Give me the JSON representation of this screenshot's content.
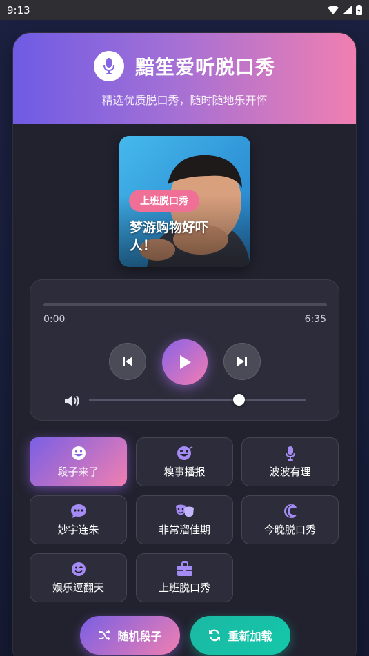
{
  "status_bar": {
    "time": "9:13",
    "icons": [
      "wifi-icon",
      "signal-icon",
      "battery-charging-icon"
    ]
  },
  "header": {
    "title": "黯笙爱听脱口秀",
    "subtitle": "精选优质脱口秀，随时随地乐开怀",
    "icon": "microphone-icon"
  },
  "now_playing": {
    "tag": "上班脱口秀",
    "title": "梦游购物好吓人！"
  },
  "player": {
    "current_time": "0:00",
    "total_time": "6:35",
    "progress": 0,
    "volume": 0.69
  },
  "categories": [
    {
      "label": "段子来了",
      "icon": "laugh-icon",
      "active": true
    },
    {
      "label": "糗事播报",
      "icon": "laugh-wink-icon",
      "active": false
    },
    {
      "label": "波波有理",
      "icon": "microphone-icon",
      "active": false
    },
    {
      "label": "妙宇连朱",
      "icon": "comment-dots-icon",
      "active": false
    },
    {
      "label": "非常溜佳期",
      "icon": "theater-masks-icon",
      "active": false
    },
    {
      "label": "今晚脱口秀",
      "icon": "moon-icon",
      "active": false
    },
    {
      "label": "娱乐逗翻天",
      "icon": "smile-wink-icon",
      "active": false
    },
    {
      "label": "上班脱口秀",
      "icon": "briefcase-icon",
      "active": false
    }
  ],
  "actions": {
    "random": {
      "label": "随机段子",
      "icon": "shuffle-icon"
    },
    "reload": {
      "label": "重新加载",
      "icon": "sync-icon"
    }
  },
  "colors": {
    "accent_purple": "#7a5fe4",
    "accent_pink": "#f07fb1",
    "accent_teal": "#14c7a9",
    "icon_purple": "#a58cf4",
    "card_bg": "#22222f"
  }
}
